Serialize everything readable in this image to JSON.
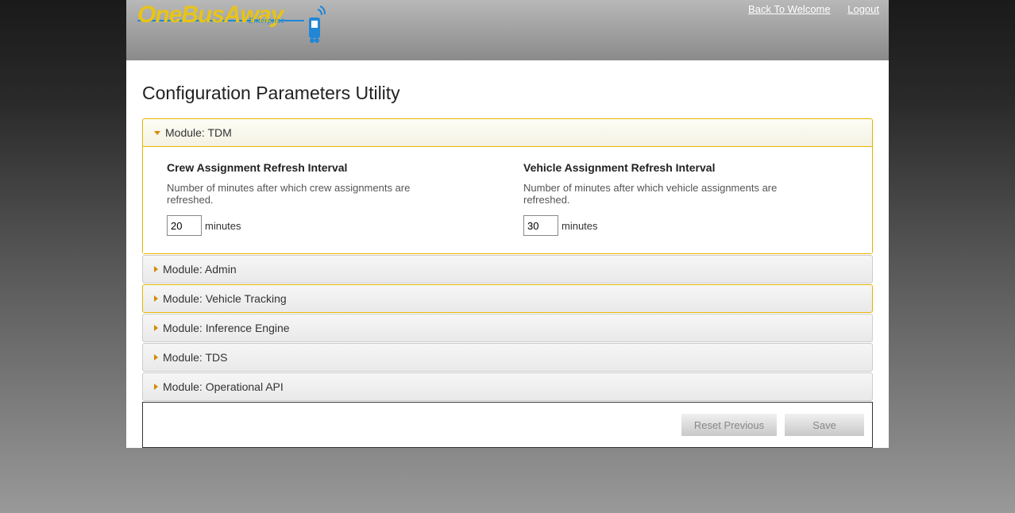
{
  "logo": {
    "main": "OneBusAway",
    "sub": "Enterprise"
  },
  "header_links": {
    "back": "Back To Welcome",
    "logout": "Logout"
  },
  "page_title": "Configuration Parameters Utility",
  "modules": {
    "tdm": {
      "label": "Module: TDM",
      "params": {
        "crew": {
          "title": "Crew Assignment Refresh Interval",
          "desc": "Number of minutes after which crew assignments are refreshed.",
          "value": "20",
          "unit": "minutes"
        },
        "vehicle": {
          "title": "Vehicle Assignment Refresh Interval",
          "desc": "Number of minutes after which vehicle assignments are refreshed.",
          "value": "30",
          "unit": "minutes"
        }
      }
    },
    "admin": {
      "label": "Module: Admin"
    },
    "vehicle_tracking": {
      "label": "Module: Vehicle Tracking"
    },
    "inference_engine": {
      "label": "Module: Inference Engine"
    },
    "tds": {
      "label": "Module: TDS"
    },
    "operational_api": {
      "label": "Module: Operational API"
    }
  },
  "actions": {
    "reset": "Reset Previous",
    "save": "Save"
  }
}
